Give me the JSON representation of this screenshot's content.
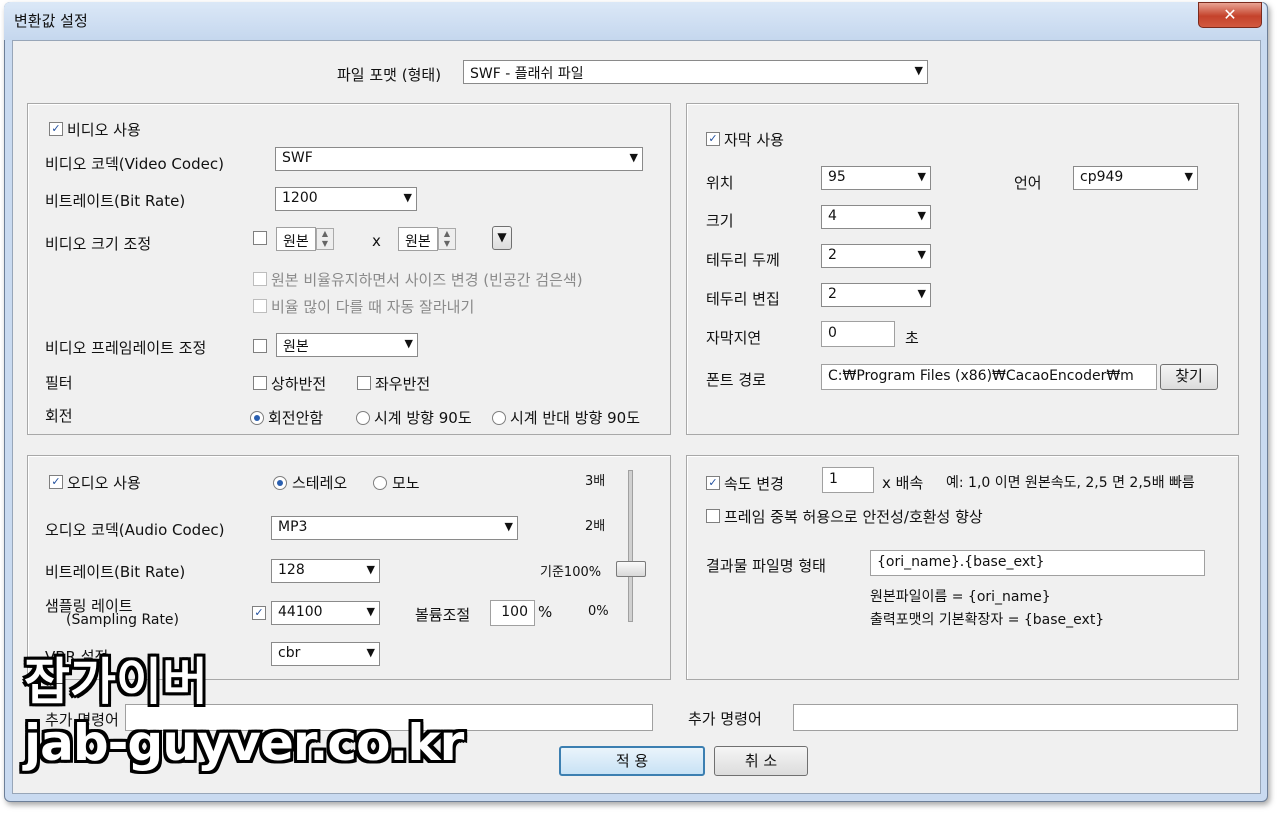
{
  "window": {
    "title": "변환값 설정",
    "close": "✕"
  },
  "file_format": {
    "label": "파일 포맷 (형태)",
    "value": "SWF - 플래쉬 파일"
  },
  "video": {
    "use_label": "비디오 사용",
    "codec_label": "비디오 코덱(Video Codec)",
    "codec_value": "SWF",
    "bitrate_label": "비트레이트(Bit Rate)",
    "bitrate_value": "1200",
    "size_label": "비디오 크기 조정",
    "width_value": "원본",
    "times": "x",
    "height_value": "원본",
    "keep_ratio_label": "원본 비율유지하면서 사이즈 변경 (빈공간 검은색)",
    "auto_crop_label": "비율 많이 다를 때 자동 잘라내기",
    "framerate_label": "비디오 프레임레이트 조정",
    "framerate_value": "원본",
    "filter_label": "필터",
    "flip_v_label": "상하반전",
    "flip_h_label": "좌우반전",
    "rotate_label": "회전",
    "rotate_none": "회전안함",
    "rotate_cw": "시계 방향 90도",
    "rotate_ccw": "시계 반대 방향 90도"
  },
  "subtitle": {
    "use_label": "자막 사용",
    "position_label": "위치",
    "position_value": "95",
    "language_label": "언어",
    "language_value": "cp949",
    "size_label": "크기",
    "size_value": "4",
    "border_thickness_label": "테두리 두께",
    "border_thickness_value": "2",
    "border_change_label": "테두리 변집",
    "border_change_value": "2",
    "delay_label": "자막지연",
    "delay_value": "0",
    "delay_unit": "초",
    "font_path_label": "폰트 경로",
    "font_path_value": "C:₩Program Files (x86)₩CacaoEncoder₩m",
    "browse_label": "찾기"
  },
  "audio": {
    "use_label": "오디오 사용",
    "stereo_label": "스테레오",
    "mono_label": "모노",
    "codec_label": "오디오 코덱(Audio Codec)",
    "codec_value": "MP3",
    "bitrate_label": "비트레이트(Bit Rate)",
    "bitrate_value": "128",
    "sampling_label_1": "샘플링 레이트",
    "sampling_label_2": "(Sampling Rate)",
    "sampling_value": "44100",
    "volume_label": "볼륨조절",
    "volume_value": "100",
    "volume_unit": "%",
    "vbr_label": "VBR 설정",
    "vbr_value": "cbr",
    "scale_3x": "3배",
    "scale_2x": "2배",
    "scale_base": "기준100%",
    "scale_0": "0%"
  },
  "speed": {
    "change_label": "속도 변경",
    "speed_value": "1",
    "speed_unit": "x 배속",
    "speed_hint": "예: 1,0 이면 원본속도, 2,5 면 2,5배 빠름",
    "frame_dup_label": "프레임 중복 허용으로 안전성/호환성 향상",
    "output_name_label": "결과물 파일명 형태",
    "output_name_value": "{ori_name}.{base_ext}",
    "hint_ori": "원본파일이름 = {ori_name}",
    "hint_ext": "출력포맷의 기본확장자 = {base_ext}"
  },
  "bottom": {
    "extra_left_label": "추가 명령어",
    "extra_cmd_label": "추가 명령어",
    "apply_label": "적 용",
    "cancel_label": "취 소"
  },
  "watermark": {
    "line1": "잡가이버",
    "line2": "jab-guyver.co.kr"
  }
}
